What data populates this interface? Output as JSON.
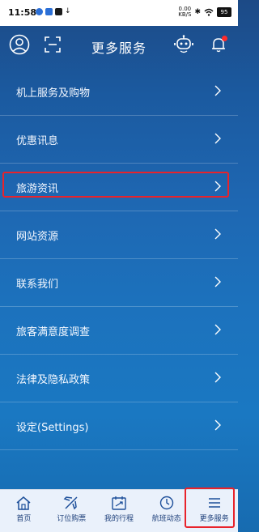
{
  "status_bar": {
    "time": "11:58",
    "net_speed_top": "0.00",
    "net_speed_bottom": "KB/S",
    "battery": "95"
  },
  "header": {
    "title": "更多服务"
  },
  "menu": {
    "items": [
      {
        "label": "机上服务及购物"
      },
      {
        "label": "优惠讯息"
      },
      {
        "label": "旅游资讯"
      },
      {
        "label": "网站资源"
      },
      {
        "label": "联系我们"
      },
      {
        "label": "旅客满意度调查"
      },
      {
        "label": "法律及隐私政策"
      },
      {
        "label": "设定(Settings)"
      }
    ]
  },
  "tabbar": {
    "tabs": [
      {
        "label": "首页",
        "icon": "home-icon"
      },
      {
        "label": "订位购票",
        "icon": "plane-icon"
      },
      {
        "label": "我的行程",
        "icon": "itinerary-icon"
      },
      {
        "label": "航班动态",
        "icon": "clock-icon"
      },
      {
        "label": "更多服务",
        "icon": "menu-icon"
      }
    ]
  },
  "colors": {
    "highlight": "#e8232b",
    "bell_badge": "#ff2b2b",
    "tab_text": "#1d3f7a"
  }
}
